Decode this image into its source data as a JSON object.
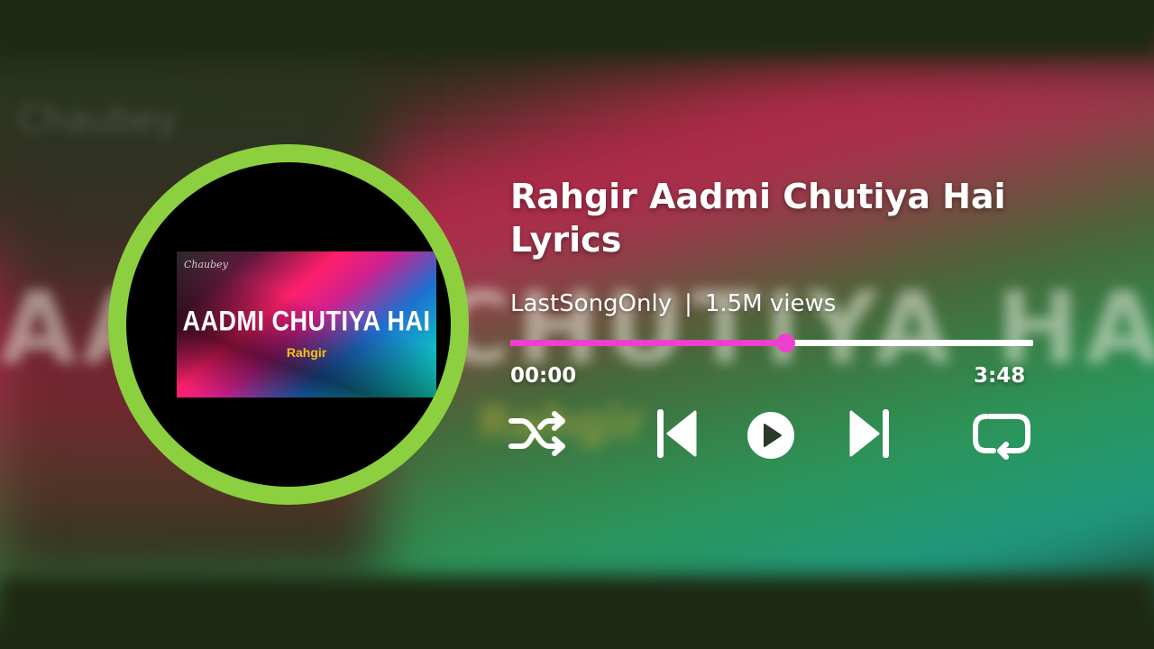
{
  "background": {
    "ghost_text": "AADMI CHUTIYA HAI",
    "ghost_small": "Chaubey",
    "ghost_sub": "Rahgir"
  },
  "album_art": {
    "logo": "Chaubey",
    "title": "AADMI CHUTIYA HAI",
    "subtitle": "Rahgir",
    "ring_color": "#8ccf3f"
  },
  "track": {
    "title": "Rahgir Aadmi Chutiya Hai Lyrics",
    "channel": "LastSongOnly",
    "separator": "|",
    "views": "1.5M views"
  },
  "player": {
    "current_time": "00:00",
    "total_time": "3:48",
    "progress_fraction": 0.526,
    "progress_color": "#ee3fcf",
    "track_color": "#ffffff",
    "controls": [
      "shuffle-icon",
      "previous-icon",
      "play-icon",
      "next-icon",
      "repeat-icon"
    ]
  }
}
